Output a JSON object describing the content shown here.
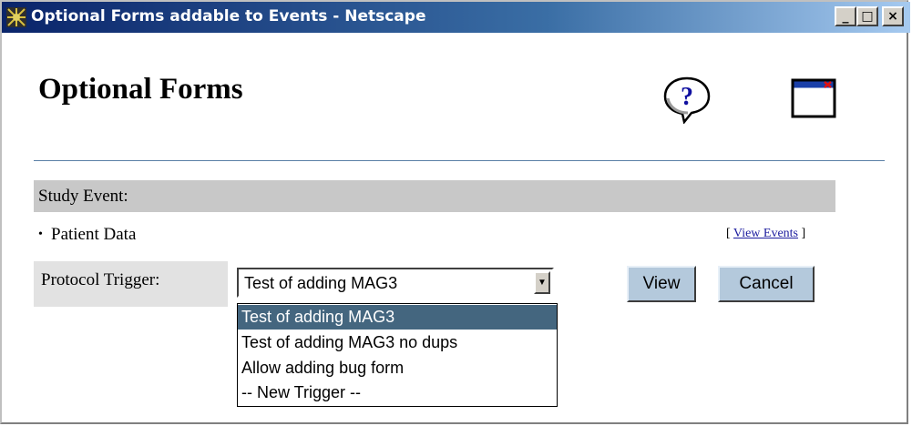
{
  "window": {
    "title": "Optional Forms addable to Events - Netscape",
    "controls": {
      "minimize": "_",
      "maximize": "□",
      "close": "×"
    }
  },
  "page": {
    "title": "Optional Forms",
    "help_icon": "help-question-icon",
    "close_icon": "close-window-icon"
  },
  "study_event": {
    "label": "Study Event:",
    "item": "Patient Data",
    "view_events_open": "[ ",
    "view_events_link": "View Events",
    "view_events_close": " ]"
  },
  "trigger": {
    "label": "Protocol Trigger:",
    "selected": "Test of adding MAG3",
    "options": [
      "Test of adding MAG3",
      "Test of adding MAG3 no dups",
      "Allow adding bug form",
      "-- New Trigger --"
    ]
  },
  "buttons": {
    "view": "View",
    "cancel": "Cancel"
  },
  "colors": {
    "titlebar_start": "#0a246a",
    "section_bar": "#c8c8c8",
    "selected_option": "#44667f",
    "button_face": "#b4c9dc"
  }
}
